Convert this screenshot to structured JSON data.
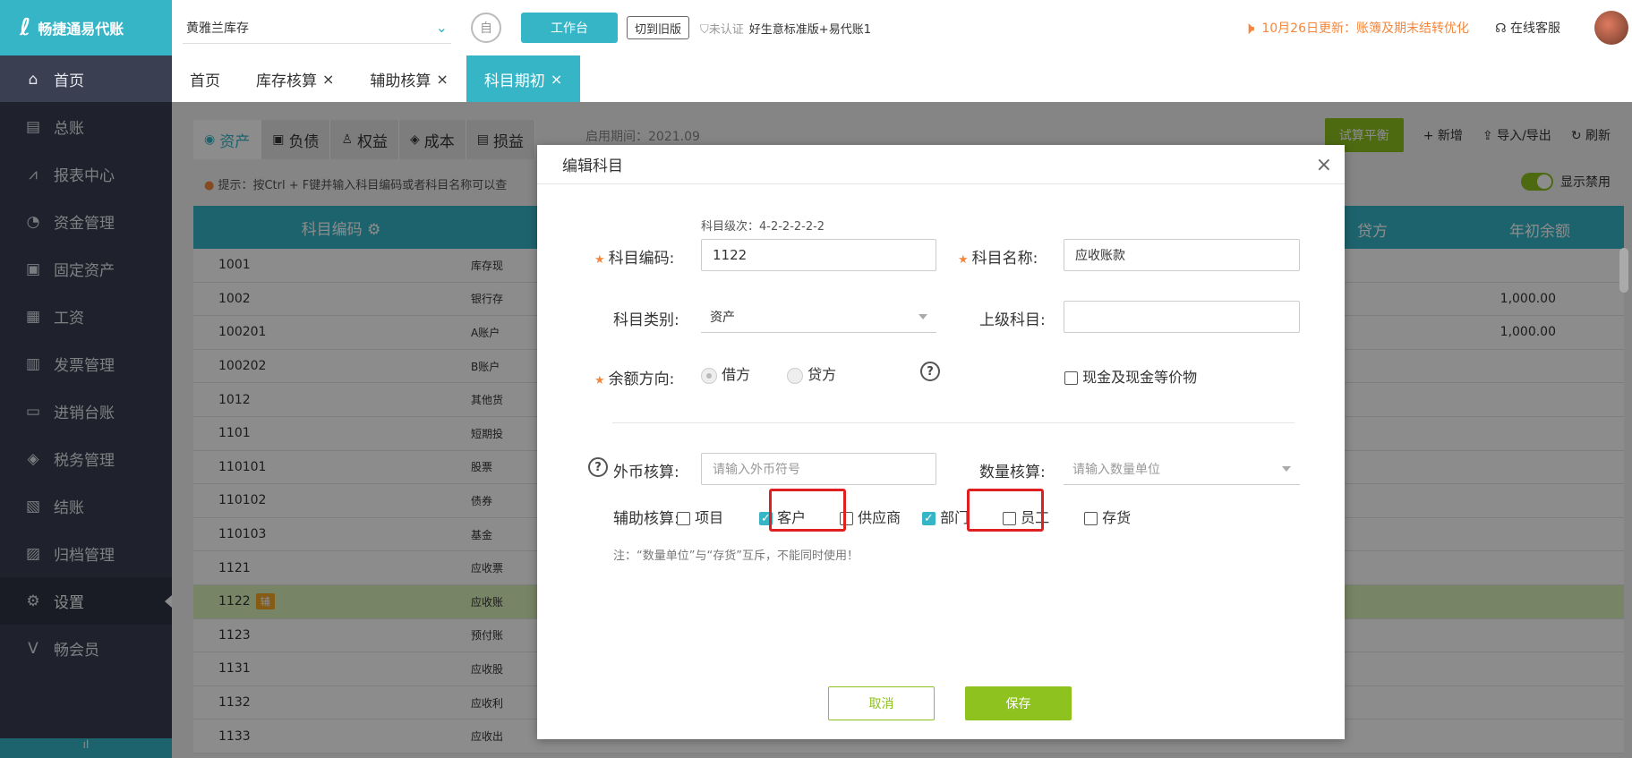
{
  "app": {
    "name": "畅捷通易代账",
    "logo_mark": "ℓ"
  },
  "header": {
    "company": "黄雅兰库存",
    "workbench_label": "工作台",
    "old_version_label": "切到旧版",
    "cert_status": "未认证",
    "plan_name": "好生意标准版+易代账1",
    "notice": "10月26日更新：账簿及期末结转优化",
    "service_label": "在线客服",
    "icon_round": "自"
  },
  "sidebar": {
    "items": [
      {
        "label": "首页",
        "icon": "⌂"
      },
      {
        "label": "总账",
        "icon": "▤"
      },
      {
        "label": "报表中心",
        "icon": "⩘"
      },
      {
        "label": "资金管理",
        "icon": "◔"
      },
      {
        "label": "固定资产",
        "icon": "▣"
      },
      {
        "label": "工资",
        "icon": "▦"
      },
      {
        "label": "发票管理",
        "icon": "▥"
      },
      {
        "label": "进销台账",
        "icon": "▭"
      },
      {
        "label": "税务管理",
        "icon": "◈"
      },
      {
        "label": "结账",
        "icon": "▧"
      },
      {
        "label": "归档管理",
        "icon": "▨"
      },
      {
        "label": "设置",
        "icon": "⚙"
      },
      {
        "label": "畅会员",
        "icon": "V"
      }
    ],
    "active_index": 11
  },
  "tabs": [
    {
      "label": "首页",
      "closable": false
    },
    {
      "label": "库存核算",
      "closable": true
    },
    {
      "label": "辅助核算",
      "closable": true
    },
    {
      "label": "科目期初",
      "closable": true,
      "active": true
    }
  ],
  "subtabs": [
    {
      "label": "资产",
      "icon": "◉",
      "active": true
    },
    {
      "label": "负债",
      "icon": "▣"
    },
    {
      "label": "权益",
      "icon": "♙"
    },
    {
      "label": "成本",
      "icon": "◈"
    },
    {
      "label": "损益",
      "icon": "▤"
    }
  ],
  "period": "启用期间：2021.09",
  "toolbar": {
    "trial_balance": "试算平衡",
    "add": "+ 新增",
    "import_export": "导入/导出",
    "refresh": "刷新"
  },
  "tip": "提示：按Ctrl + F键并输入科目编码或者科目名称可以查",
  "show_disabled": "显示禁用",
  "table": {
    "col_code": "科目编码",
    "col_credit": "贷方",
    "col_year": "年初余额",
    "rows": [
      {
        "code": "1001",
        "name": "库存现",
        "year": ""
      },
      {
        "code": "1002",
        "name": "银行存",
        "year": "1,000.00"
      },
      {
        "code": "100201",
        "name": "A账户",
        "year": "1,000.00"
      },
      {
        "code": "100202",
        "name": "B账户",
        "year": ""
      },
      {
        "code": "1012",
        "name": "其他货",
        "year": ""
      },
      {
        "code": "1101",
        "name": "短期投",
        "year": ""
      },
      {
        "code": "110101",
        "name": "股票",
        "year": ""
      },
      {
        "code": "110102",
        "name": "债券",
        "year": ""
      },
      {
        "code": "110103",
        "name": "基金",
        "year": ""
      },
      {
        "code": "1121",
        "name": "应收票",
        "year": ""
      },
      {
        "code": "1122",
        "name": "应收账",
        "year": "",
        "badge": "辅",
        "selected": true
      },
      {
        "code": "1123",
        "name": "预付账",
        "year": ""
      },
      {
        "code": "1131",
        "name": "应收股",
        "year": ""
      },
      {
        "code": "1132",
        "name": "应收利",
        "year": ""
      },
      {
        "code": "1133",
        "name": "应收出",
        "year": ""
      }
    ]
  },
  "modal": {
    "title": "编辑科目",
    "close": "×",
    "level_text": "科目级次：4-2-2-2-2-2",
    "code_label": "科目编码:",
    "code_value": "1122",
    "name_label": "科目名称:",
    "name_value": "应收账款",
    "type_label": "科目类别:",
    "type_value": "资产",
    "parent_label": "上级科目:",
    "parent_value": "",
    "balance_label": "余额方向:",
    "debit": "借方",
    "credit": "贷方",
    "cash_equiv": "现金及现金等价物",
    "fx_label": "外币核算:",
    "fx_placeholder": "请输入外币符号",
    "qty_label": "数量核算:",
    "qty_placeholder": "请输入数量单位",
    "aux_label": "辅助核算:",
    "aux_options": [
      {
        "label": "项目",
        "checked": false
      },
      {
        "label": "客户",
        "checked": true
      },
      {
        "label": "供应商",
        "checked": false
      },
      {
        "label": "部门",
        "checked": true
      },
      {
        "label": "员工",
        "checked": false
      },
      {
        "label": "存货",
        "checked": false
      }
    ],
    "note": "注：“数量单位”与“存货”互斥，不能同时使用！",
    "cancel": "取消",
    "save": "保存"
  }
}
